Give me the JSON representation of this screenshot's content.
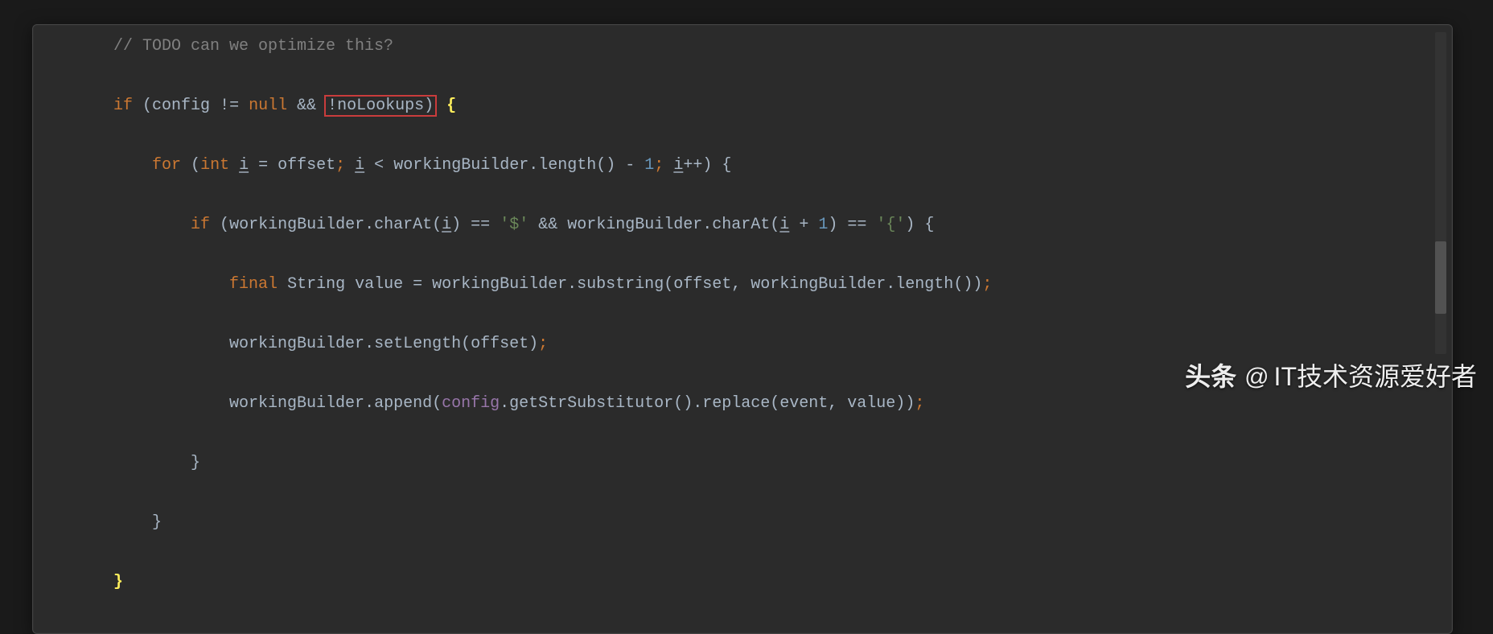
{
  "code": {
    "comment": "// TODO can we optimize this?",
    "kw_if": "if",
    "var_config": "config",
    "op_ne": " != ",
    "kw_null": "null",
    "op_and": " && ",
    "op_not": "!",
    "var_noLookups": "noLookups",
    "kw_for": "for",
    "kw_int": "int",
    "var_i": "i",
    "var_i_u1": "i",
    "var_i_u2": "i",
    "var_i_u3": "i",
    "var_i_u4": "i",
    "op_assign": " = ",
    "var_offset": "offset",
    "semicolon": "; ",
    "op_lt": " < ",
    "var_wb": "workingBuilder",
    "dot": ".",
    "m_length": "length",
    "m_charAt": "charAt",
    "m_substring": "substring",
    "m_setLength": "setLength",
    "m_append": "append",
    "m_getStrSubstitutor": "getStrSubstitutor",
    "m_replace": "replace",
    "op_minus": " - ",
    "num_1": "1",
    "op_inc": "++",
    "op_eq": " == ",
    "str_dollar": "'$'",
    "str_brace": "'{'",
    "op_plus": " + ",
    "kw_final": "final",
    "type_String": "String",
    "var_value": "value",
    "var_event": "event",
    "comma_sp": ", ",
    "lparen": "(",
    "rparen": ")",
    "lbrace": " {",
    "rbrace": "}",
    "empty_parens": "()",
    "semi": ";"
  },
  "watermark": {
    "logo": "头条",
    "at": "@",
    "name": "IT技术资源爱好者"
  }
}
